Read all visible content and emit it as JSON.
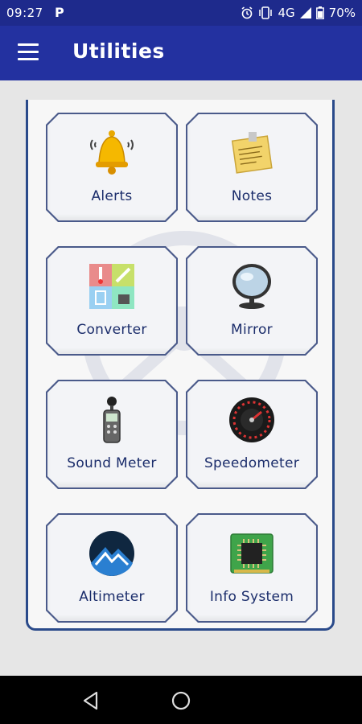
{
  "status_bar": {
    "time": "09:27",
    "network": "4G",
    "battery": "70%",
    "icons": [
      "parking-icon",
      "alarm-icon",
      "vibrate-icon",
      "signal-icon",
      "battery-icon"
    ]
  },
  "app_bar": {
    "title": "Utilities",
    "menu_icon": "hamburger-menu-icon"
  },
  "tiles": [
    {
      "label": "Alerts",
      "icon": "bell-icon"
    },
    {
      "label": "Notes",
      "icon": "notes-icon"
    },
    {
      "label": "Converter",
      "icon": "converter-icon"
    },
    {
      "label": "Mirror",
      "icon": "mirror-icon"
    },
    {
      "label": "Sound Meter",
      "icon": "sound-meter-icon"
    },
    {
      "label": "Speedometer",
      "icon": "speedometer-icon"
    },
    {
      "label": "Altimeter",
      "icon": "altimeter-icon"
    },
    {
      "label": "Info System",
      "icon": "chip-icon"
    }
  ],
  "nav_bar": {
    "icons": [
      "back-icon",
      "home-icon"
    ]
  },
  "colors": {
    "primary": "#2331a0",
    "status": "#1e2a8c",
    "label": "#1b2d6b",
    "border": "#4a5a8a"
  }
}
